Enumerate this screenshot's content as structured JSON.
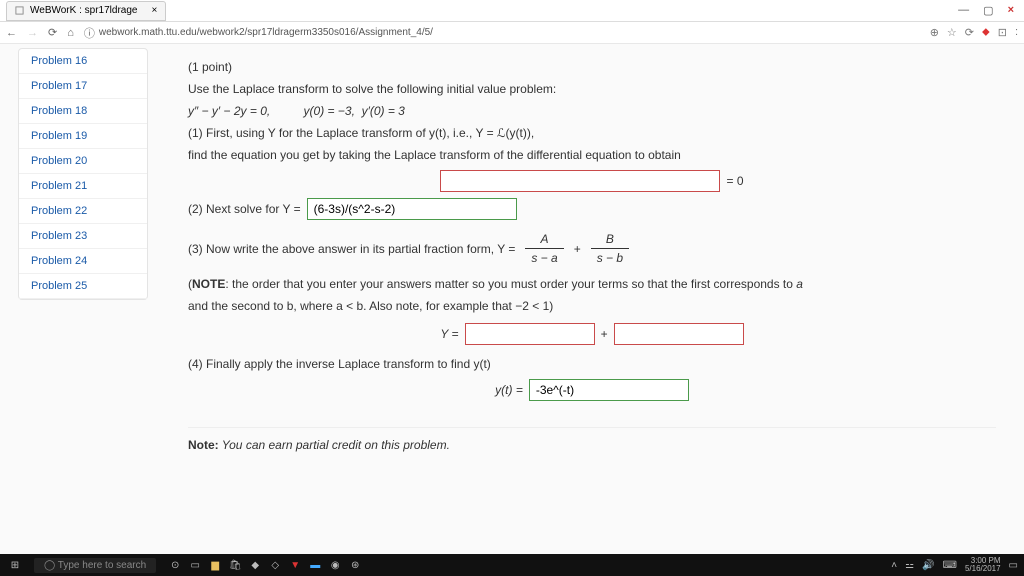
{
  "tab": {
    "title": "WeBWorK : spr17ldrage",
    "close": "×"
  },
  "window": {
    "min": "—",
    "max": "▢",
    "close": "×"
  },
  "toolbar": {
    "info": "ⓘ",
    "url": "webwork.math.ttu.edu/webwork2/spr17ldragerm3350s016/Assignment_4/5/",
    "icons": [
      "⊕",
      "☆",
      "⟳",
      "⬥",
      "⊡",
      ":"
    ]
  },
  "sidebar": {
    "items": [
      "Problem 16",
      "Problem 17",
      "Problem 18",
      "Problem 19",
      "Problem 20",
      "Problem 21",
      "Problem 22",
      "Problem 23",
      "Problem 24",
      "Problem 25"
    ]
  },
  "problem": {
    "points": "(1 point)",
    "intro": "Use the Laplace transform to solve the following initial value problem:",
    "equation": "y″ − y′ − 2y = 0,          y(0) = −3,  y′(0) = 3",
    "part1a": "(1) First, using Y for the Laplace transform of y(t), i.e., Y = ℒ(y(t)),",
    "part1b": "find the equation you get by taking the Laplace transform of the differential equation to obtain",
    "eq_zero": "= 0",
    "part2_label": "(2) Next solve for Y =",
    "ans2": "(6-3s)/(s^2-s-2)",
    "part3_label": "(3) Now write the above answer in its partial fraction form, Y =",
    "fracA_num": "A",
    "fracA_den": "s − a",
    "plus": "+",
    "fracB_num": "B",
    "fracB_den": "s − b",
    "note1": "(NOTE: the order that you enter your answers matter so you must order your terms so that the first corresponds to a",
    "note2": "and the second to b, where a < b. Also note, for example that −2 < 1)",
    "Y_eq": "Y =",
    "part4": "(4) Finally apply the inverse Laplace transform to find y(t)",
    "yt_eq": "y(t) =",
    "ans4": "-3e^(-t)",
    "footer_note_b": "Note:",
    "footer_note_i": " You can earn partial credit on this problem."
  },
  "taskbar": {
    "search_placeholder": "Type here to search",
    "time": "3:00 PM",
    "date": "5/16/2017"
  }
}
